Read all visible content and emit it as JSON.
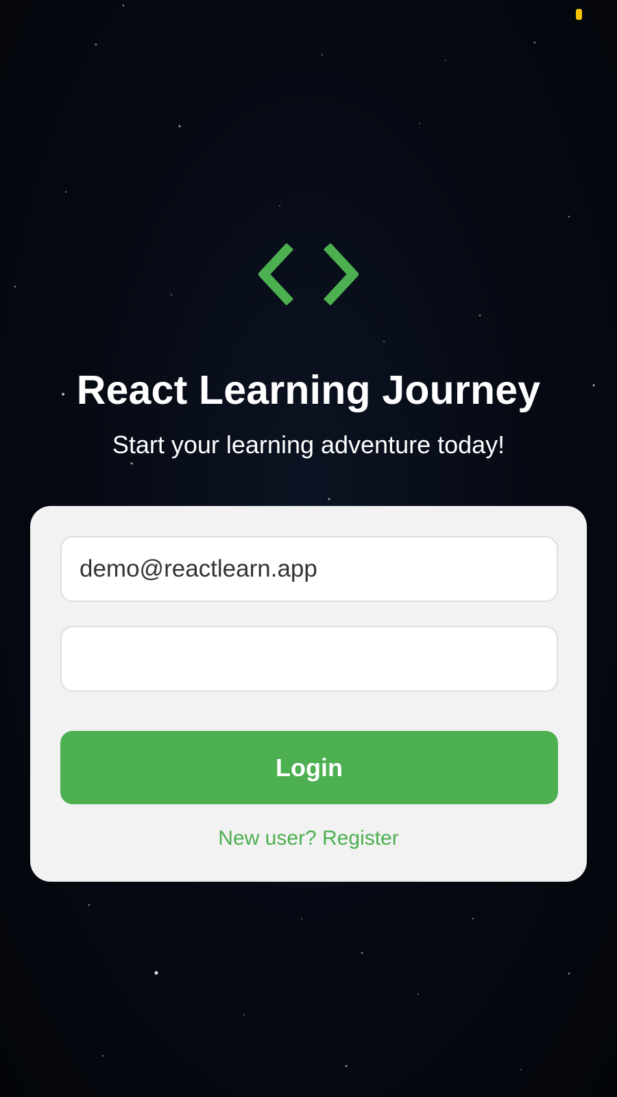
{
  "status": {
    "indicator_color": "#f5c400"
  },
  "logo": {
    "icon": "code-brackets-icon",
    "color": "#4caf50"
  },
  "header": {
    "title": "React Learning Journey",
    "subtitle": "Start your learning adventure today!"
  },
  "login_form": {
    "email": {
      "value": "demo@reactlearn.app",
      "placeholder": ""
    },
    "password": {
      "value": "",
      "placeholder": ""
    },
    "login_label": "Login",
    "register_label": "New user? Register"
  },
  "colors": {
    "accent": "#4caf50",
    "background": "#05070d",
    "card": "#f2f2f2"
  }
}
